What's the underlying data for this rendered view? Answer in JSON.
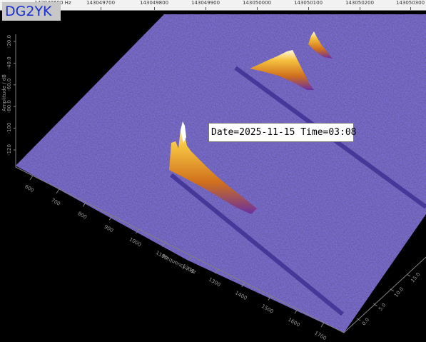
{
  "overlay": {
    "callsign": "DG2YK",
    "timestamp": "Date=2025-11-15 Time=03:08"
  },
  "top_ruler": {
    "labels": [
      "143049600 Hz",
      "143049700",
      "143049800",
      "143049900",
      "143050000",
      "143050100",
      "143050200",
      "143050300"
    ]
  },
  "axes": {
    "frequency_label": "Frequency / Hz",
    "frequency_ticks": [
      "600",
      "700",
      "800",
      "900",
      "1000",
      "1100",
      "1200",
      "1300",
      "1400",
      "1500",
      "1600",
      "1700"
    ],
    "amplitude_label": "Amplitude / dB",
    "amplitude_ticks": [
      "-20.0",
      "-40.0",
      "-60.0",
      "-80.0",
      "-100",
      "-120"
    ],
    "time_ticks": [
      "0.0",
      "5.0",
      "10.0",
      "15.0"
    ]
  },
  "colors": {
    "background": "#000000",
    "noise_floor": "#2d2a85",
    "peak_low": "#e08a1e",
    "peak_high": "#fffbe6",
    "callsign": "#1a2fd0"
  }
}
